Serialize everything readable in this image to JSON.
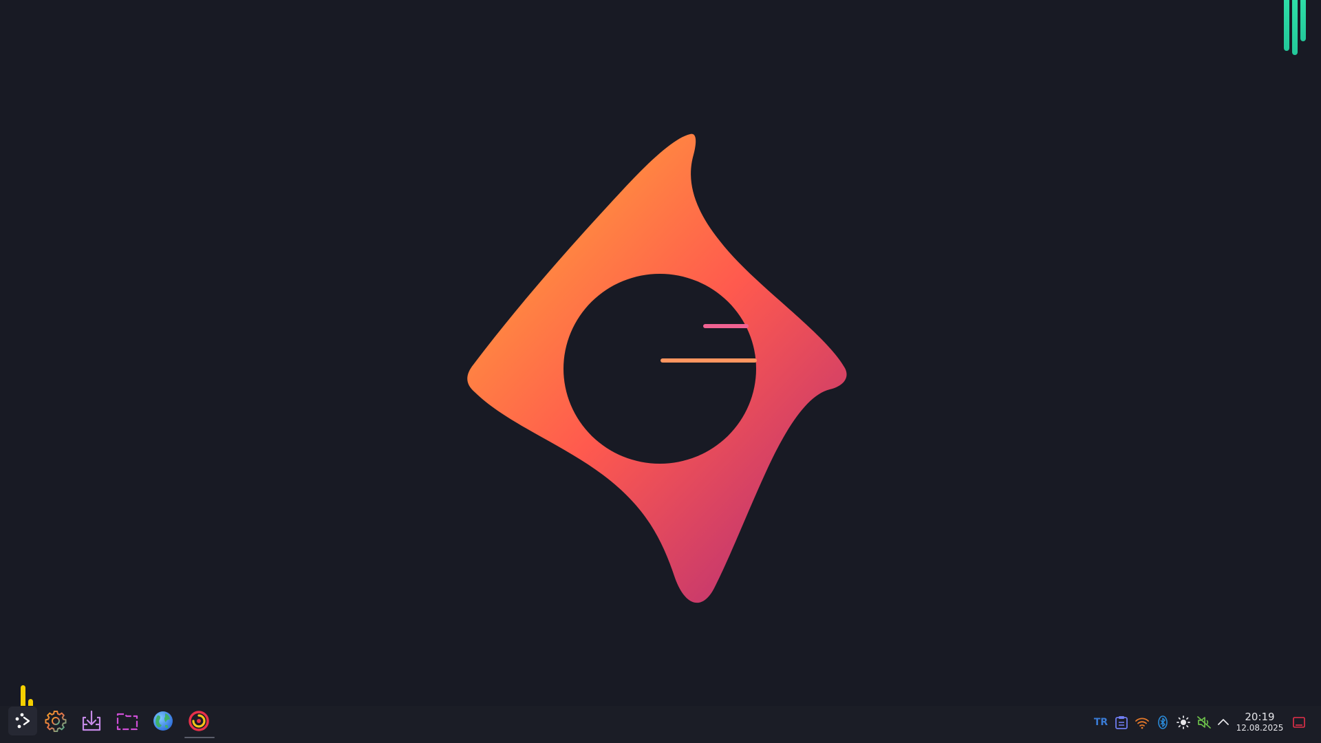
{
  "desktop": {
    "background_color": "#181a24",
    "wallpaper": {
      "logo_gradient": [
        "#ff9a3c",
        "#ff5a4e",
        "#c2366f"
      ],
      "speed_lines": [
        "#f06292",
        "#5b8def",
        "#ff9660"
      ]
    }
  },
  "taskbar": {
    "apps": [
      {
        "name": "application-launcher",
        "icon": "launcher-icon"
      },
      {
        "name": "system-settings",
        "icon": "gear-icon"
      },
      {
        "name": "software-center",
        "icon": "download-box-icon"
      },
      {
        "name": "file-manager",
        "icon": "folder-icon"
      },
      {
        "name": "web-browser",
        "icon": "globe-icon"
      },
      {
        "name": "active-app",
        "icon": "swirl-icon",
        "active": true
      }
    ],
    "tray": {
      "keyboard_layout": "TR",
      "icons": [
        "clipboard-icon",
        "wifi-icon",
        "bluetooth-icon",
        "brightness-icon",
        "volume-muted-icon",
        "chevron-up-icon",
        "show-desktop-icon"
      ]
    },
    "clock": {
      "time": "20:19",
      "date": "12.08.2025"
    }
  }
}
